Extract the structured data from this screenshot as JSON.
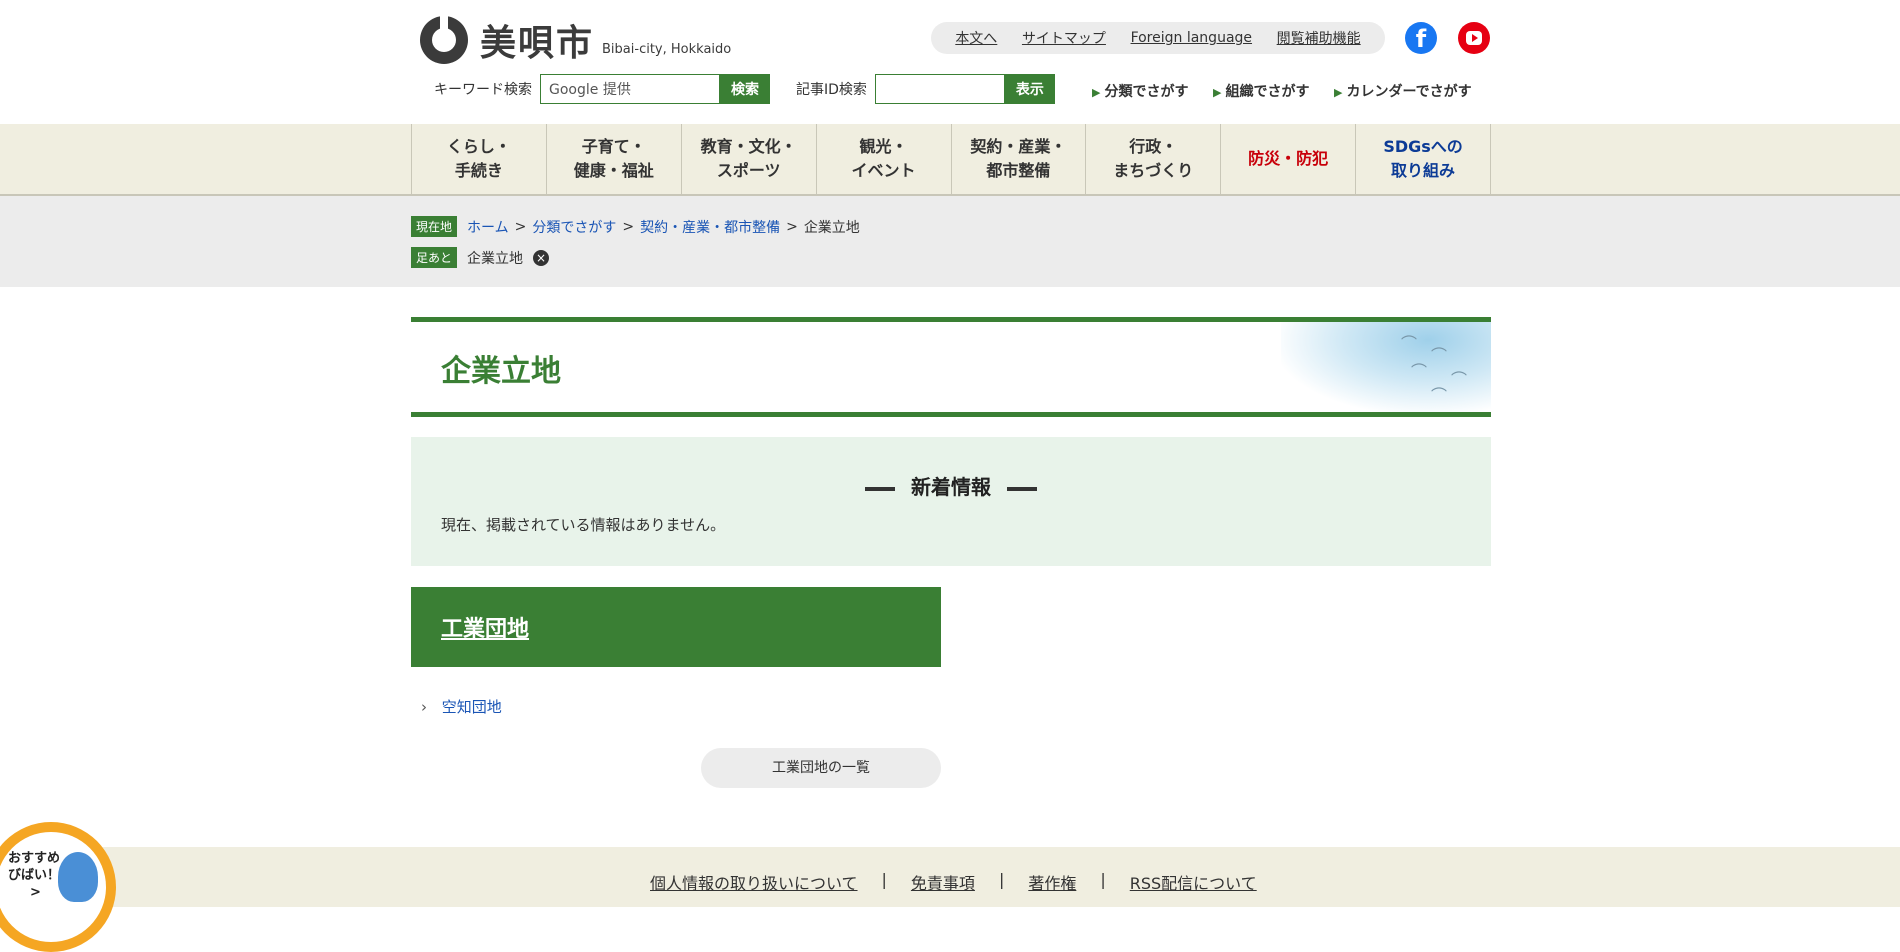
{
  "header": {
    "logo_jp": "美唄市",
    "logo_en": "Bibai-city, Hokkaido",
    "util_links": [
      "本文へ",
      "サイトマップ",
      "Foreign language",
      "閲覧補助機能"
    ],
    "facebook_glyph": "f"
  },
  "search": {
    "keyword_label": "キーワード検索",
    "keyword_placeholder": "Google 提供",
    "keyword_button": "検索",
    "id_label": "記事ID検索",
    "id_placeholder": "",
    "id_button": "表示"
  },
  "quick_links": [
    "分類でさがす",
    "組織でさがす",
    "カレンダーでさがす"
  ],
  "gnav": [
    {
      "line1": "くらし・",
      "line2": "手続き"
    },
    {
      "line1": "子育て・",
      "line2": "健康・福祉"
    },
    {
      "line1": "教育・文化・",
      "line2": "スポーツ"
    },
    {
      "line1": "観光・",
      "line2": "イベント"
    },
    {
      "line1": "契約・産業・",
      "line2": "都市整備"
    },
    {
      "line1": "行政・",
      "line2": "まちづくり"
    },
    {
      "line1": "防災・防犯",
      "line2": ""
    },
    {
      "line1": "SDGsへの",
      "line2": "取り組み"
    }
  ],
  "breadcrumb": {
    "current_tag": "現在地",
    "items": [
      "ホーム",
      "分類でさがす",
      "契約・産業・都市整備",
      "企業立地"
    ],
    "footprint_tag": "足あと",
    "footprint_item": "企業立地",
    "close_glyph": "×"
  },
  "page": {
    "title": "企業立地",
    "news_heading": "新着情報",
    "news_empty": "現在、掲載されている情報はありません。",
    "section_title": "工業団地",
    "section_link": "空知団地",
    "section_more": "工業団地の一覧"
  },
  "footer": {
    "links": [
      "個人情報の取り扱いについて",
      "免責事項",
      "著作権",
      "RSS配信について"
    ],
    "divider": "|"
  },
  "mascot": {
    "line1": "おすすめ",
    "line2": "びばい！",
    "line3": ">"
  },
  "colors": {
    "brand_green": "#3a7f34",
    "nav_bg": "#f0eee0",
    "alert_red": "#c8000a",
    "sdgs_blue": "#0c3b96"
  }
}
